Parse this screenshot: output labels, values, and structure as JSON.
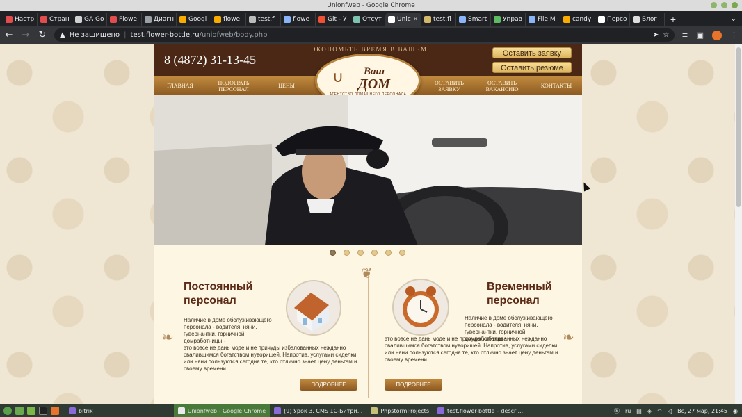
{
  "window": {
    "title": "Unionfweb - Google Chrome"
  },
  "tabs": [
    {
      "label": "Настр",
      "color": "#e34c4c"
    },
    {
      "label": "Стран",
      "color": "#e34c4c"
    },
    {
      "label": "GA Go",
      "color": "#d0d0d0"
    },
    {
      "label": "Flowe",
      "color": "#e34c4c"
    },
    {
      "label": "Диагн",
      "color": "#9aa0a6"
    },
    {
      "label": "Googl",
      "color": "#f9ab00"
    },
    {
      "label": "flowe",
      "color": "#f9ab00"
    },
    {
      "label": "test.fl",
      "color": "#bbbbbb"
    },
    {
      "label": "flowe",
      "color": "#8ab4f8"
    },
    {
      "label": "Git - У",
      "color": "#f05033"
    },
    {
      "label": "Отсут",
      "color": "#7ec3b0"
    },
    {
      "label": "Unic",
      "color": "#ffffff",
      "active": true
    },
    {
      "label": "test.fl",
      "color": "#d4b86a"
    },
    {
      "label": "Smart",
      "color": "#8ab4f8"
    },
    {
      "label": "Управ",
      "color": "#5dbb63"
    },
    {
      "label": "File M",
      "color": "#8ab4f8"
    },
    {
      "label": "candy",
      "color": "#f9ab00"
    },
    {
      "label": "Персо",
      "color": "#ffffff"
    },
    {
      "label": "Блог",
      "color": "#dddddd"
    }
  ],
  "address": {
    "warning": "Не защищено",
    "host": "test.flower-bottle.ru",
    "path": "/uniofweb/body.php"
  },
  "site": {
    "phone": "8 (4872) 31-13-45",
    "slogan": "ЭКОНОМЬТЕ ВРЕМЯ В ВАШЕМ ДОМЕ",
    "btn_request": "Оставить заявку",
    "btn_resume": "Оставить резюме",
    "logo_main_1": "Ваш",
    "logo_main_2": "ДОМ",
    "logo_sub": "АГЕНТСТВО ДОМАШНЕГО ПЕРСОНАЛА",
    "nav": [
      {
        "label": "ГЛАВНАЯ"
      },
      {
        "label": "ПОДОБРАТЬ ПЕРСОНАЛ"
      },
      {
        "label": "ЦЕНЫ"
      },
      {
        "label": "ОСТАВИТЬ ЗАЯВКУ"
      },
      {
        "label": "ОСТАВИТЬ ВАКАНСИЮ"
      },
      {
        "label": "КОНТАКТЫ"
      }
    ],
    "slider": {
      "count": 6,
      "active_index": 0
    },
    "permanent": {
      "title_1": "Постоянный",
      "title_2": "персонал",
      "text": "Наличие в доме обслуживающего персонала - водителя, няни, гувернантки, горничной, домработницы - это вовсе не дань моде и не причуды избалованных нежданно свалившимся богатством нуворишей. Напротив, услугами сиделки или няни пользуются сегодня те, кто отлично знает цену деньгам и своему времени.",
      "button": "ПОДРОБНЕЕ"
    },
    "temporary": {
      "title_1": "Временный",
      "title_2": "персонал",
      "text": "Наличие в доме обслуживающего персонала - водителя, няни, гувернантки, горничной, домработницы - это вовсе не дань моде и не причуды избалованных нежданно свалившимся богатством нуворишей. Напротив, услугами сиделки или няни пользуются сегодня те, кто отлично знает цену деньгам и своему времени.",
      "button": "ПОДРОБНЕЕ"
    }
  },
  "taskbar": {
    "apps": [
      {
        "label": "bitrix",
        "active": false
      },
      {
        "label": "Unionfweb - Google Chrome",
        "active": true
      },
      {
        "label": "(9) Урок 3. CMS 1С-Битри...",
        "active": false
      },
      {
        "label": "PhpstormProjects",
        "active": false
      },
      {
        "label": "test.flower-bottle – descri...",
        "active": false
      }
    ],
    "lang": "ru",
    "clock": "Вс, 27 мар, 21:45"
  }
}
